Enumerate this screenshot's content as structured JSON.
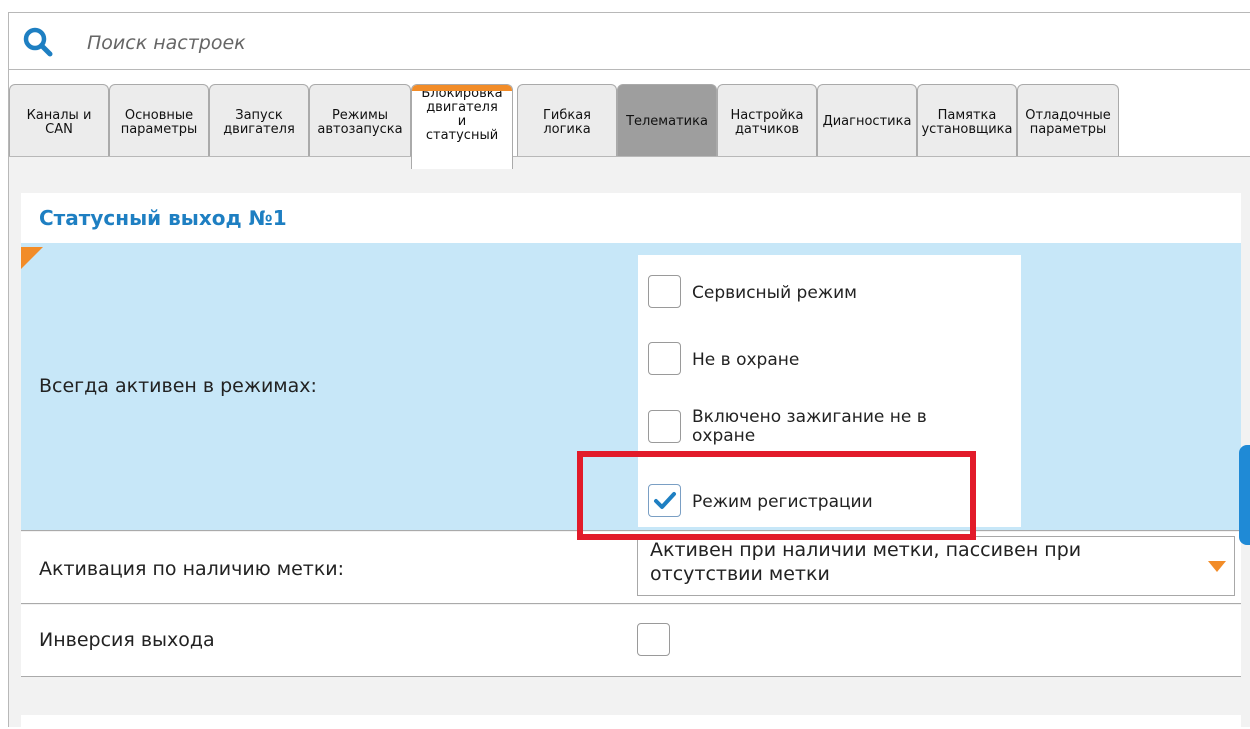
{
  "search": {
    "placeholder": "Поиск настроек",
    "icon": "search-icon"
  },
  "tabs": [
    {
      "lines": [
        "Каналы и",
        "CAN"
      ]
    },
    {
      "lines": [
        "Основные",
        "параметры"
      ]
    },
    {
      "lines": [
        "Запуск",
        "двигателя"
      ]
    },
    {
      "lines": [
        "Режимы",
        "автозапуска"
      ]
    },
    {
      "lines": [
        "Блокировка",
        "двигателя",
        "и",
        "статусный"
      ],
      "active": true
    },
    {
      "lines": [
        "Гибкая",
        "логика"
      ]
    },
    {
      "lines": [
        "Телематика"
      ],
      "dark": true
    },
    {
      "lines": [
        "Настройка",
        "датчиков"
      ]
    },
    {
      "lines": [
        "Диагностика"
      ]
    },
    {
      "lines": [
        "Памятка",
        "установщика"
      ]
    },
    {
      "lines": [
        "Отладочные",
        "параметры"
      ]
    }
  ],
  "section": {
    "title": "Статусный выход №1"
  },
  "modes_row": {
    "label": "Всегда активен в режимах:",
    "options": [
      {
        "label": "Сервисный режим",
        "checked": false
      },
      {
        "label": "Не в охране",
        "checked": false
      },
      {
        "label": "Включено зажигание не в охране",
        "checked": false
      },
      {
        "label": "Режим регистрации",
        "checked": true
      }
    ]
  },
  "activation_row": {
    "label": "Активация по наличию метки:",
    "selected": "Активен при наличии метки, пассивен при отсутствии метки"
  },
  "inversion_row": {
    "label": "Инверсия выхода",
    "checked": false
  },
  "colors": {
    "accent": "#f28c28",
    "title": "#1e7fc2",
    "highlight": "#e21b2a",
    "selected_row": "#c7e7f8",
    "checkmark": "#1e7fc2"
  }
}
